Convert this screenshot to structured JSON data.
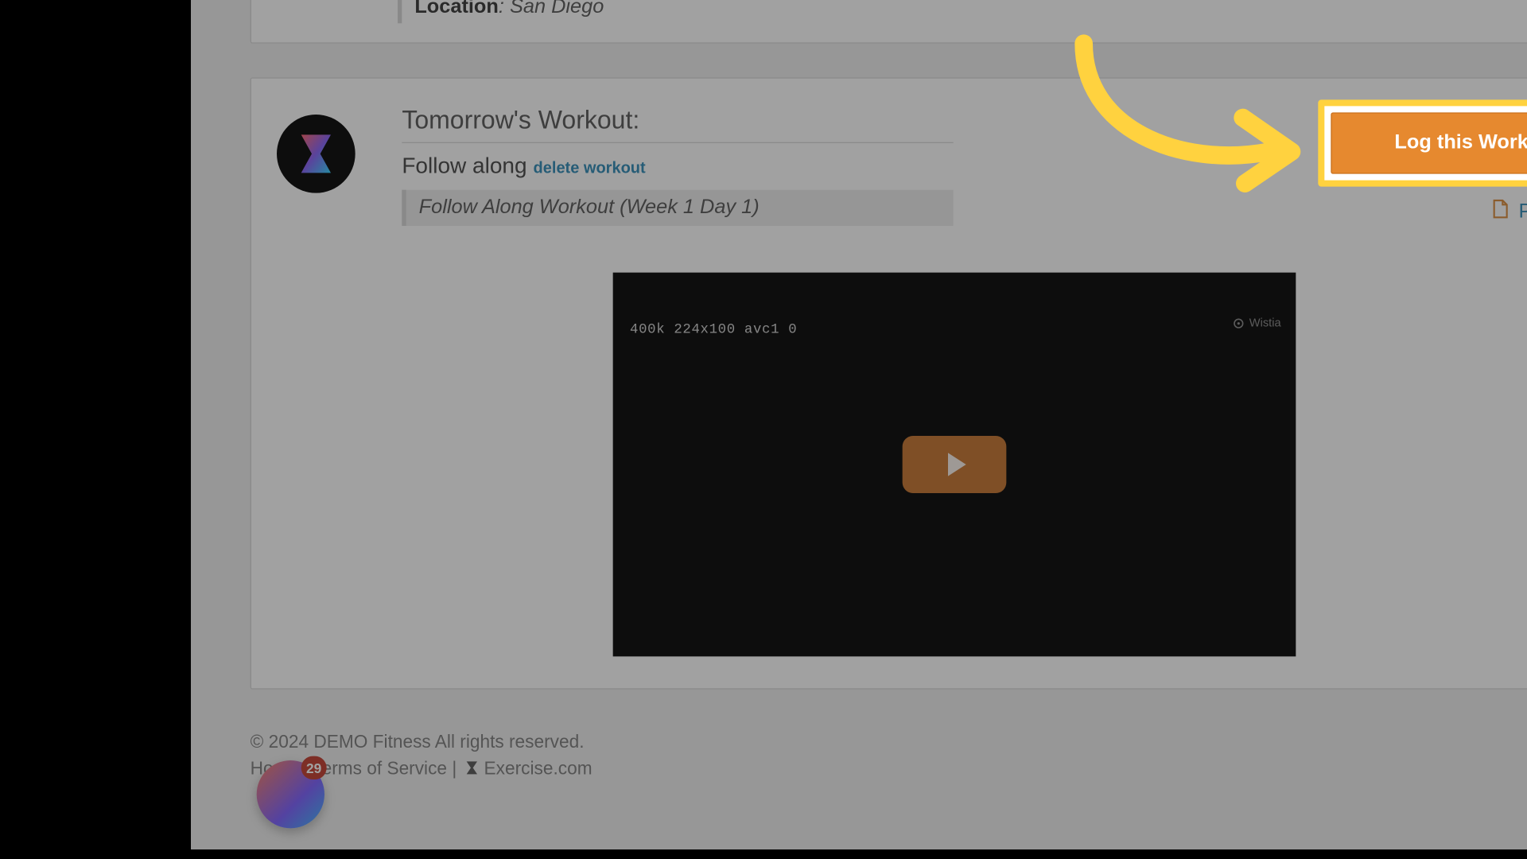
{
  "top_card": {
    "location_label": "Location",
    "location_value": ": San Diego"
  },
  "workout": {
    "section_title": "Tomorrow's Workout:",
    "plan_label": "Follow along",
    "delete_label": "delete workout",
    "plan_note": "Follow Along Workout (Week 1 Day 1)"
  },
  "actions": {
    "log_label": "Log this Workout",
    "print_label": "Print workout"
  },
  "video": {
    "debug_text": "400k  224x100 avc1 0",
    "watermark": "Wistia"
  },
  "footer": {
    "copyright": "© 2024 DEMO Fitness All rights reserved.",
    "home": "Home",
    "tos": "Terms of Service",
    "exercise": "Exercise.com"
  },
  "chat": {
    "badge_count": "29"
  }
}
